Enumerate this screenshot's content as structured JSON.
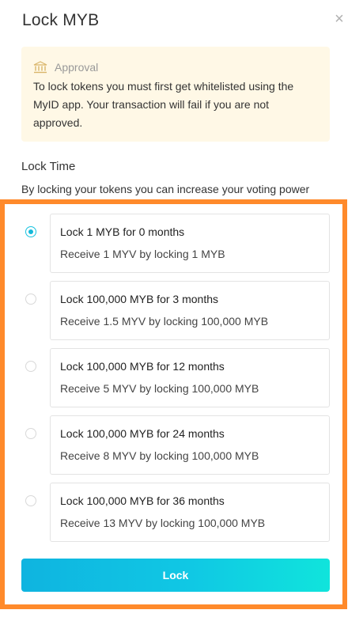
{
  "header": {
    "title": "Lock MYB",
    "close_label": "×"
  },
  "notice": {
    "icon": "bank-icon",
    "title": "Approval",
    "text": "To lock tokens you must first get whitelisted using the MyID app. Your transaction will fail if you are not approved."
  },
  "lock_time": {
    "heading": "Lock Time",
    "description": "By locking your tokens you can increase your voting power"
  },
  "options": [
    {
      "title": "Lock 1 MYB for 0 months",
      "detail": "Receive 1 MYV by locking 1 MYB",
      "selected": true
    },
    {
      "title": "Lock 100,000 MYB for 3 months",
      "detail": "Receive 1.5 MYV by locking 100,000 MYB",
      "selected": false
    },
    {
      "title": "Lock 100,000 MYB for 12 months",
      "detail": "Receive 5 MYV by locking 100,000 MYB",
      "selected": false
    },
    {
      "title": "Lock 100,000 MYB for 24 months",
      "detail": "Receive 8 MYV by locking 100,000 MYB",
      "selected": false
    },
    {
      "title": "Lock 100,000 MYB for 36 months",
      "detail": "Receive 13 MYV by locking 100,000 MYB",
      "selected": false
    }
  ],
  "actions": {
    "lock_label": "Lock"
  },
  "colors": {
    "accent": "#14b8d9",
    "highlight": "#ff8a2b",
    "notice_bg": "#fff8e6"
  }
}
